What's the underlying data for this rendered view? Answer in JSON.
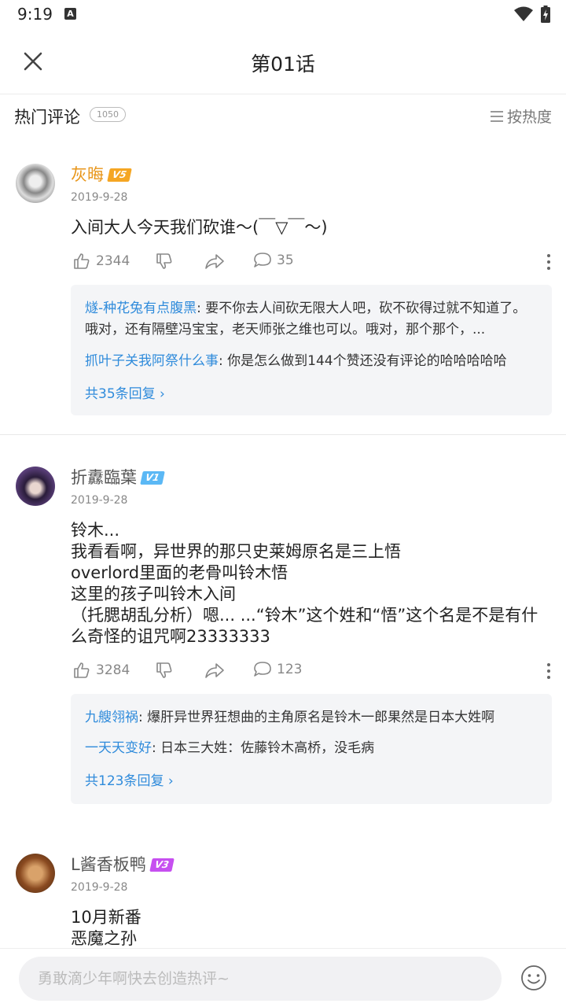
{
  "status": {
    "time": "9:19",
    "a_icon": "A"
  },
  "header": {
    "title": "第01话"
  },
  "section": {
    "title": "热门评论",
    "count": "1050",
    "sort_label": "按热度"
  },
  "comments": [
    {
      "user": "灰晦",
      "level": "V5",
      "level_color": "#f5a623",
      "name_color": "#e8961a",
      "date": "2019-9-28",
      "text": "入间大人今天我们砍谁～(￣▽￣～)",
      "likes": "2344",
      "replies_count": "35",
      "replies": [
        {
          "name": "燧-种花兔有点腹黑",
          "text": ": 要不你去人间砍无限大人吧，砍不砍得过就不知道了。哦对，还有隔壁冯宝宝，老天师张之维也可以。哦对，那个那个，..."
        },
        {
          "name": "抓叶子关我阿祭什么事",
          "text": ": 你是怎么做到144个赞还没有评论的哈哈哈哈哈"
        }
      ],
      "all_replies": "共35条回复 ›"
    },
    {
      "user": "折纛臨葉",
      "level": "V1",
      "level_color": "#5bb8f5",
      "name_color": "#555555",
      "date": "2019-9-28",
      "text": "铃木...\n我看看啊，异世界的那只史莱姆原名是三上悟\noverlord里面的老骨叫铃木悟\n这里的孩子叫铃木入间\n（托腮胡乱分析）嗯... ...“铃木”这个姓和“悟”这个名是不是有什么奇怪的诅咒啊23333333",
      "likes": "3284",
      "replies_count": "123",
      "replies": [
        {
          "name": "九艘翎祸",
          "text": ": 爆肝异世界狂想曲的主角原名是铃木一郎果然是日本大姓啊"
        },
        {
          "name": "一天天变好",
          "text": ": 日本三大姓：佐藤铃木高桥，没毛病"
        }
      ],
      "all_replies": "共123条回复 ›"
    },
    {
      "user": "L酱香板鸭",
      "level": "V3",
      "level_color": "#c64ff0",
      "name_color": "#555555",
      "date": "2019-9-28",
      "text": "10月新番\n恶魔之孙"
    }
  ],
  "bottom": {
    "placeholder": "勇敢滴少年啊快去创造热评~"
  },
  "icons": [
    "close-icon",
    "sort-icon",
    "like-icon",
    "dislike-icon",
    "share-icon",
    "comment-icon",
    "more-icon",
    "emoji-icon",
    "wifi-icon",
    "battery-icon"
  ]
}
